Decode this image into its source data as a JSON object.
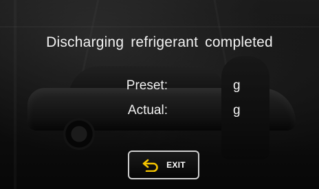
{
  "screen": {
    "title": "Discharging  refrigerant  completed"
  },
  "rows": {
    "preset_label": "Preset:",
    "preset_unit": "g",
    "actual_label": "Actual:",
    "actual_unit": "g"
  },
  "exit_button": {
    "label": "EXIT",
    "icon": "return-arrow-icon",
    "icon_color": "#f5c400"
  }
}
